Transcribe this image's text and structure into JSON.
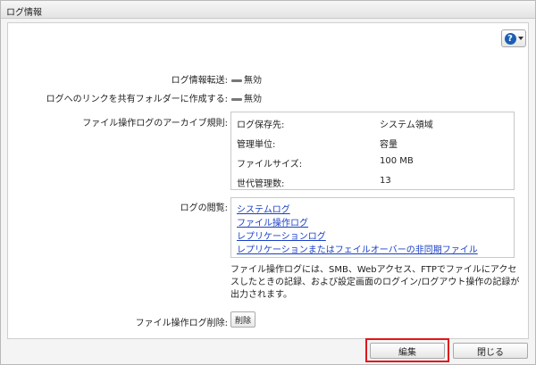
{
  "window": {
    "title": "ログ情報"
  },
  "fields": {
    "log_transfer": {
      "label": "ログ情報転送:",
      "value": "無効"
    },
    "share_link": {
      "label": "ログへのリンクを共有フォルダーに作成する:",
      "value": "無効"
    },
    "archive_rule": {
      "label": "ファイル操作ログのアーカイブ規則:",
      "rows": [
        {
          "key": "ログ保存先:",
          "value": "システム領域"
        },
        {
          "key": "管理単位:",
          "value": "容量"
        },
        {
          "key": "ファイルサイズ:",
          "value": "100 MB"
        },
        {
          "key": "世代管理数:",
          "value": "13"
        }
      ]
    },
    "log_view": {
      "label": "ログの閲覧:",
      "links": [
        "システムログ",
        "ファイル操作ログ",
        "レプリケーションログ",
        "レプリケーションまたはフェイルオーバーの非同期ファイル"
      ]
    },
    "description": "ファイル操作ログには、SMB、Webアクセス、FTPでファイルにアクセスしたときの記録、および設定画面のログイン/ログアウト操作の記録が出力されます。",
    "delete_log": {
      "label": "ファイル操作ログ削除:",
      "button": "削除"
    }
  },
  "footer": {
    "edit_label": "編集",
    "close_label": "閉じる"
  },
  "icons": {
    "help": "help-icon",
    "toggle": "toggle-off-icon"
  },
  "colors": {
    "link": "#1a3fc4",
    "highlight": "#e0161b",
    "help": "#1a5fb4"
  }
}
